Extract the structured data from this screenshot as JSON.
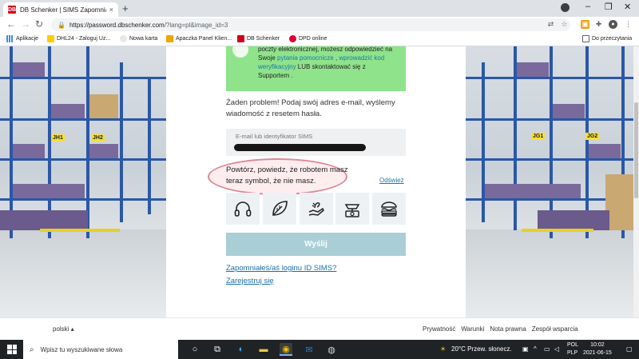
{
  "browser": {
    "tab_title": "DB Schenker | SIMS Zapomniane",
    "tab_close": "×",
    "new_tab": "+",
    "url_host": "https://password.dbschenker.com",
    "url_path": "/?lang=pl&image_id=3"
  },
  "bookmarks": {
    "apps": "Aplikacje",
    "items": [
      "DHL24 - Zaloguj Uz...",
      "Nowa karta",
      "Apaczka Panel Klien...",
      "DB Schenker",
      "DPD online"
    ],
    "reading_list": "Do przeczytania"
  },
  "page": {
    "alert_line1": "poczty elektronicznej, możesz odpowiedzieć na",
    "alert_line2_a": "Swoje ",
    "alert_line2_link1": "pytania pomocnicze",
    "alert_line2_b": " , ",
    "alert_line2_link2": "wprowadzić kod",
    "alert_line3_link": "weryfikacyjny",
    "alert_line3_b": " LUB skontaktować się z",
    "alert_line4": "Supportem .",
    "intro": "Żaden problem! Podaj swój adres e-mail, wyślemy wiadomość z resetem hasła.",
    "email_label": "E-mail lub identyfikator SIMS",
    "captcha_prompt": "Powtórz, powiedz, że robotem masz teraz symbol, że nie masz.",
    "refresh": "Odśwież",
    "captcha_icons": [
      "headphones-icon",
      "leaf-icon",
      "hand-icon",
      "scale-icon",
      "burger-icon"
    ],
    "submit": "Wyślij",
    "forgot_login": "Zapomniałeś/aś loginu ID SIMS?",
    "register": "Zarejestruj się"
  },
  "footer": {
    "language": "polski ▴",
    "links": [
      "Prywatność",
      "Warunki",
      "Nota prawna",
      "Zespół wsparcia"
    ]
  },
  "taskbar": {
    "search_placeholder": "Wpisz tu wyszukiwane słowa",
    "weather": "20°C  Przew. słonecz.",
    "lang_top": "POL",
    "lang_bottom": "PLP",
    "time": "10:02",
    "date": "2021-06-15"
  },
  "warehouse_labels": {
    "left": [
      "JH1",
      "JH2"
    ],
    "right": [
      "JG1",
      "JG2"
    ]
  }
}
